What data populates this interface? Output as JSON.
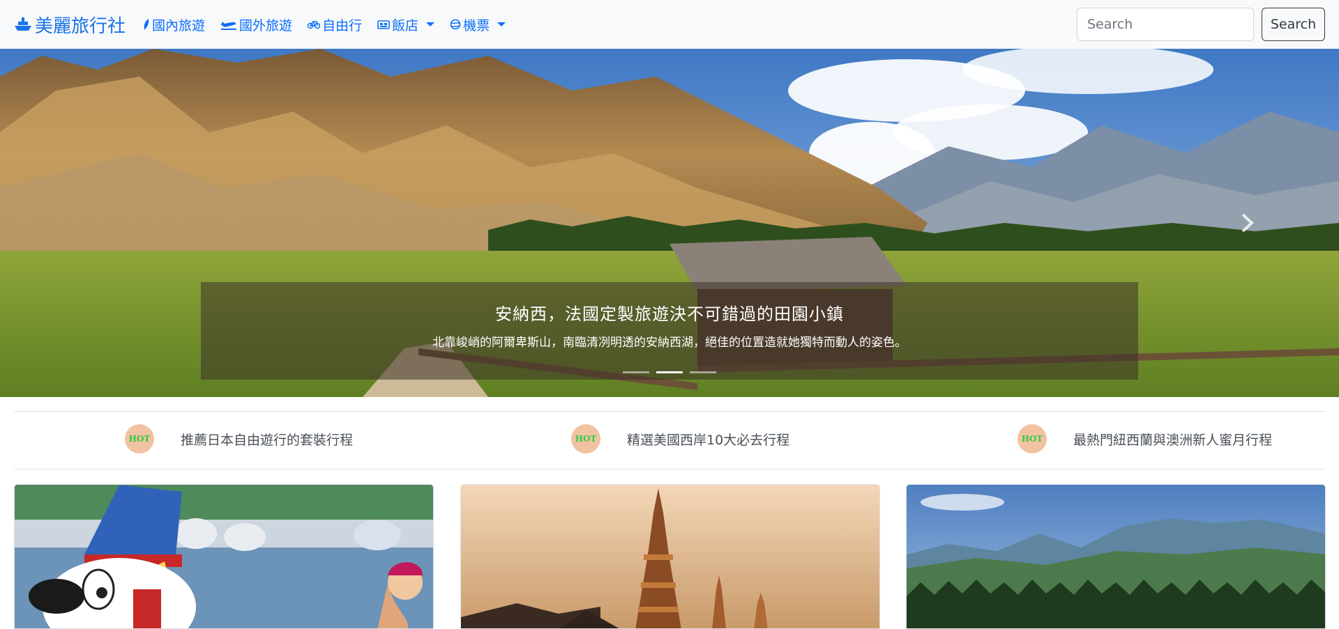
{
  "navbar": {
    "brand": "美麗旅行社",
    "brand_icon": "ship-icon",
    "links": [
      {
        "label": "國內旅遊",
        "icon": "leaf-icon"
      },
      {
        "label": "國外旅遊",
        "icon": "airplane-icon"
      },
      {
        "label": "自由行",
        "icon": "bicycle-icon"
      },
      {
        "label": "飯店",
        "icon": "hotel-icon",
        "dropdown": true
      },
      {
        "label": "機票",
        "icon": "globe-icon",
        "dropdown": true
      }
    ],
    "search_placeholder": "Search",
    "search_button": "Search"
  },
  "carousel": {
    "caption_title": "安納西，法國定製旅遊決不可錯過的田園小鎮",
    "caption_text": "北靠峻峭的阿爾卑斯山，南臨清冽明透的安納西湖，絕佳的位置造就她獨特而動人的姿色。",
    "slide_count": 3,
    "active_index": 1
  },
  "hot": {
    "badge": "HOT",
    "items": [
      "推薦日本自由遊行的套裝行程",
      "精選美國西岸10大必去行程",
      "最熱門紐西蘭與澳洲新人蜜月行程"
    ]
  },
  "cards": [
    {
      "image": "theme-park-mascot-photo"
    },
    {
      "image": "thai-temple-pagoda-photo"
    },
    {
      "image": "mountain-forest-photo"
    }
  ],
  "colors": {
    "link": "#0d6efd",
    "brand": "#1a73e8",
    "hot_badge_bg": "#f2c3a2",
    "hot_badge_text": "#2ecc40"
  }
}
